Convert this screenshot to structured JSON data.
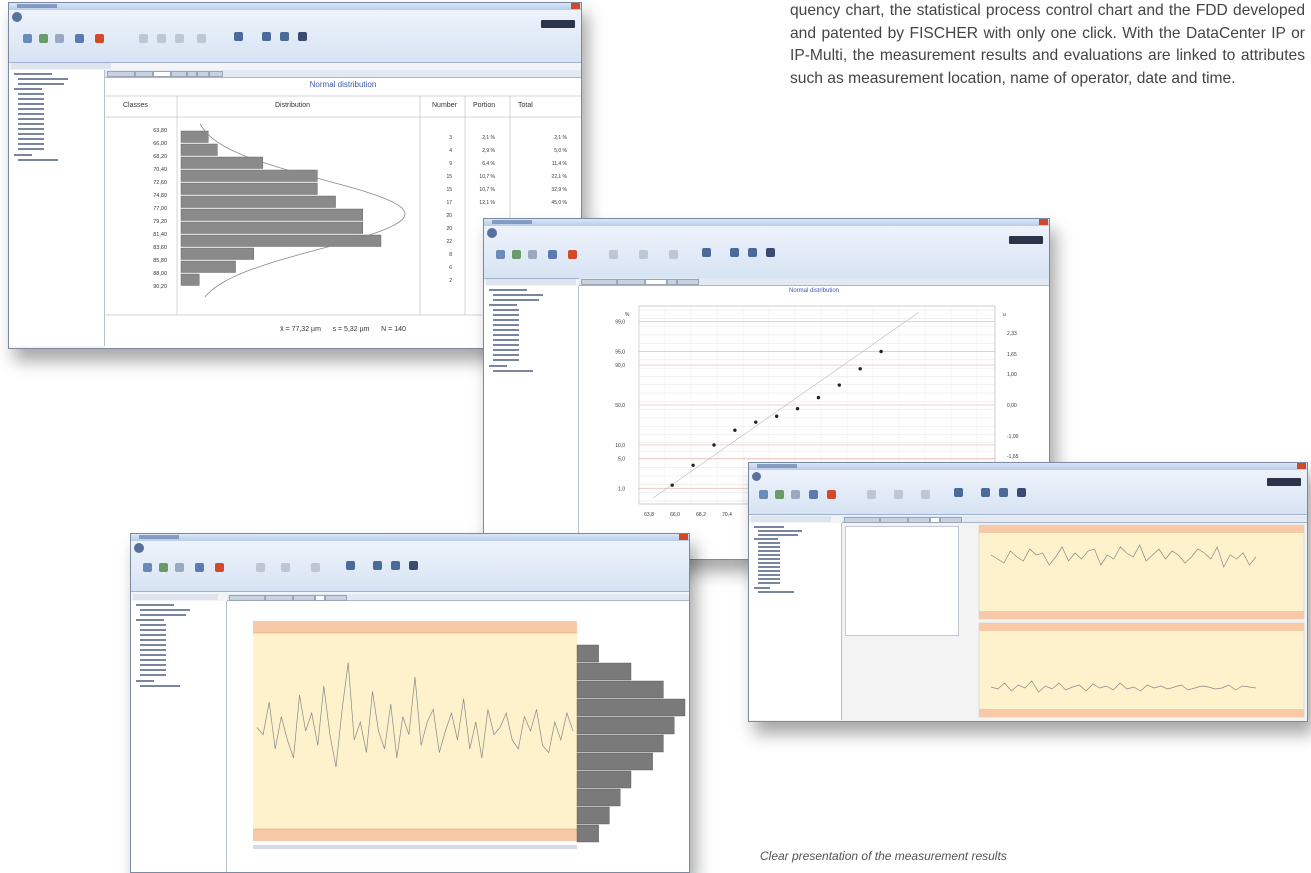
{
  "intro_text": "quency chart, the statistical process control chart and the FDD developed and patented by FISCHER with only one click. With the DataCenter IP or IP-Multi, the measurement results and evaluations are linked to attributes such as measurement location, name of operator, date and time.",
  "caption": "Clear presentation of the measurement results",
  "window1": {
    "chart_title": "Normal distribution",
    "headers": {
      "classes": "Classes",
      "distribution": "Distribution",
      "number": "Number",
      "portion": "Portion",
      "total": "Total"
    },
    "stats": {
      "mean": "x̄ = 77,32 µm",
      "sd": "s = 5,32 µm",
      "n": "N = 140"
    },
    "chart_data": {
      "type": "bar",
      "title": "Normal distribution",
      "categories": [
        "63,80",
        "66,00",
        "68,20",
        "70,40",
        "72,60",
        "74,80",
        "77,00",
        "79,20",
        "81,40",
        "83,60",
        "85,80",
        "88,00",
        "90,20"
      ],
      "values": [
        3,
        4,
        9,
        15,
        15,
        17,
        20,
        20,
        22,
        8,
        6,
        2,
        0
      ],
      "portion": [
        "2,1 %",
        "2,9 %",
        "6,4 %",
        "10,7 %",
        "10,7 %",
        "12,1 %",
        "",
        "",
        "",
        "",
        "",
        "",
        ""
      ],
      "total": [
        "2,1 %",
        "5,0 %",
        "11,4 %",
        "22,1 %",
        "32,9 %",
        "45,0 %",
        "",
        "",
        "",
        "",
        "",
        "",
        ""
      ]
    }
  },
  "window2": {
    "chart_title": "Normal distribution",
    "chart_data": {
      "type": "scatter",
      "title": "Normal distribution",
      "xlabel": "",
      "ylabel": "%",
      "y2label": "u",
      "x_ticks": [
        "63,8",
        "66,0",
        "68,2",
        "70,4",
        "72"
      ],
      "y_ticks": [
        "99,9",
        "99,0",
        "95,0",
        "90,0",
        "50,0",
        "10,0",
        "5,0",
        "1,0"
      ],
      "y2_ticks": [
        "2,33",
        "1,65",
        "1,00",
        "0,00",
        "-1,00",
        "-1,65"
      ],
      "x": [
        66.0,
        68.2,
        70.4,
        72.6,
        74.8,
        77.0,
        79.2,
        81.4,
        83.6,
        85.8,
        88.0
      ],
      "y": [
        1.2,
        3.5,
        10,
        20,
        28,
        35,
        45,
        60,
        75,
        88,
        95
      ]
    }
  },
  "window3": {
    "chart_data": {
      "type": "line",
      "title": "",
      "values": [
        52,
        48,
        66,
        40,
        58,
        45,
        35,
        70,
        50,
        60,
        42,
        75,
        48,
        30,
        62,
        88,
        45,
        55,
        38,
        72,
        50,
        40,
        65,
        35,
        58,
        48,
        80,
        42,
        55,
        62,
        38,
        50,
        60,
        45,
        68,
        40,
        55,
        35,
        62,
        48,
        52,
        60,
        45,
        40,
        58,
        50,
        62,
        42,
        38,
        55,
        45,
        60,
        50
      ],
      "hist_values": [
        2,
        5,
        8,
        10,
        9,
        8,
        7,
        5,
        4,
        3,
        2
      ]
    }
  },
  "window4": {
    "chart_data": [
      {
        "type": "line",
        "title": "",
        "values": [
          40,
          36,
          32,
          44,
          38,
          34,
          46,
          40,
          42,
          30,
          38,
          48,
          34,
          42,
          36,
          44,
          46,
          30,
          40,
          36,
          48,
          42,
          38,
          50,
          34,
          40,
          46,
          36,
          44,
          40,
          32,
          38,
          46,
          42,
          36,
          48,
          28,
          40,
          36,
          42,
          30,
          38
        ]
      },
      {
        "type": "line",
        "title": "",
        "values": [
          20,
          18,
          24,
          16,
          22,
          19,
          26,
          15,
          21,
          18,
          24,
          17,
          20,
          22,
          16,
          23,
          19,
          21,
          17,
          24,
          18,
          20,
          16,
          22,
          19,
          21,
          18,
          20,
          22,
          17,
          19,
          21,
          20,
          18,
          19,
          22,
          17,
          21,
          20,
          19
        ]
      }
    ]
  }
}
